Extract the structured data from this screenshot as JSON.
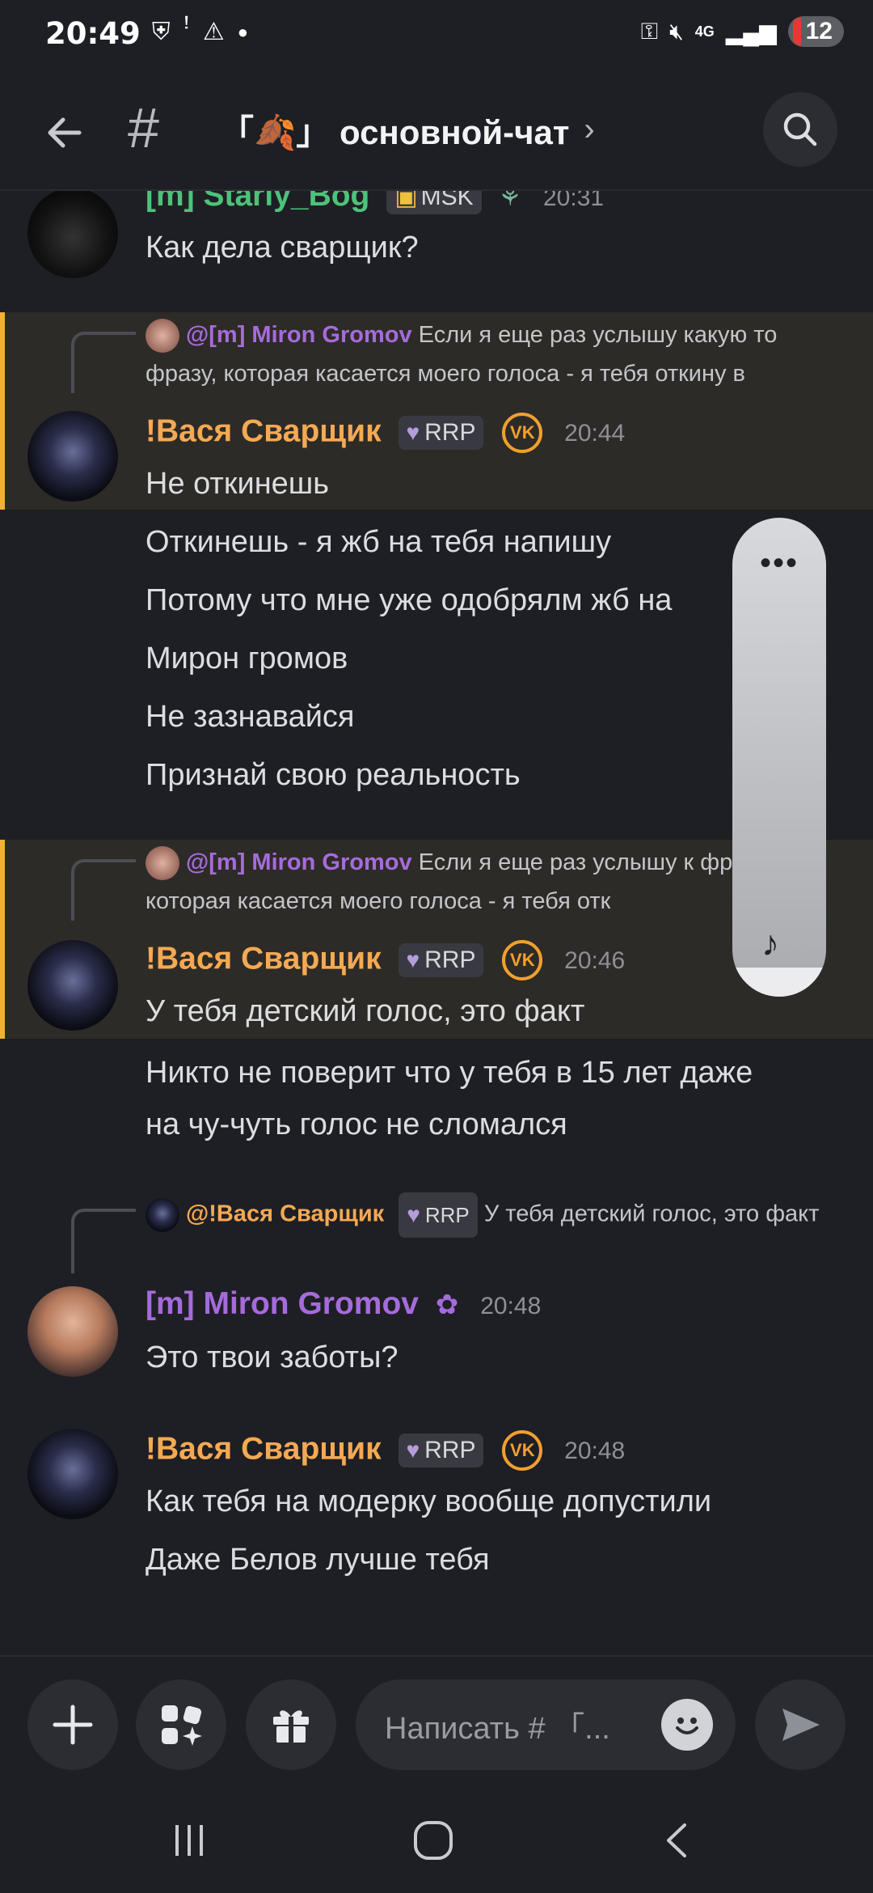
{
  "status_bar": {
    "time": "20:49",
    "battery": "12",
    "network": "4G"
  },
  "header": {
    "channel_name": "「🍂」 основной-чат",
    "chevron": "›"
  },
  "messages": [
    {
      "author": "[m] Starly_Bog",
      "tag": "MSK",
      "time": "20:31",
      "lines": [
        "Как дела сварщик?"
      ]
    },
    {
      "reply_author": "@[m] Miron Gromov",
      "reply_text": "Если я еще раз услышу какую то фразу, которая касается моего голоса - я тебя откину в",
      "author": "!Вася Сварщик",
      "tag": "RRP",
      "vk": "VK",
      "time": "20:44",
      "lines": [
        "Не откинешь"
      ]
    },
    {
      "lines": [
        "Откинешь - я жб на тебя напишу",
        "Потому что мне уже одобрялм жб на",
        "Мирон громов",
        "Не зазнавайся",
        "Признай свою реальность"
      ]
    },
    {
      "reply_author": "@[m] Miron Gromov",
      "reply_text": "Если я еще раз услышу к фразу, которая касается моего голоса - я тебя отк",
      "author": "!Вася Сварщик",
      "tag": "RRP",
      "vk": "VK",
      "time": "20:46",
      "lines": [
        "У тебя детский голос, это факт"
      ]
    },
    {
      "lines": [
        "Никто не поверит что у тебя в 15 лет даже",
        "на чу-чуть голос не сломался"
      ]
    },
    {
      "reply_author": "@!Вася Сварщик",
      "reply_tag": "RRP",
      "reply_text": "У тебя детский голос, это факт",
      "author": "[m] Miron Gromov",
      "time": "20:48",
      "lines": [
        "Это твои заботы?"
      ]
    },
    {
      "author": "!Вася Сварщик",
      "tag": "RRP",
      "vk": "VK",
      "time": "20:48",
      "lines": [
        "Как тебя на модерку вообще допустили",
        "Даже Белов лучше тебя"
      ]
    }
  ],
  "composer": {
    "placeholder": "Написать # 「..."
  },
  "colors": {
    "accent_orange": "#f5a953",
    "accent_green": "#4ec27a",
    "accent_purple": "#a66bdb",
    "highlight_border": "#f0b232"
  }
}
